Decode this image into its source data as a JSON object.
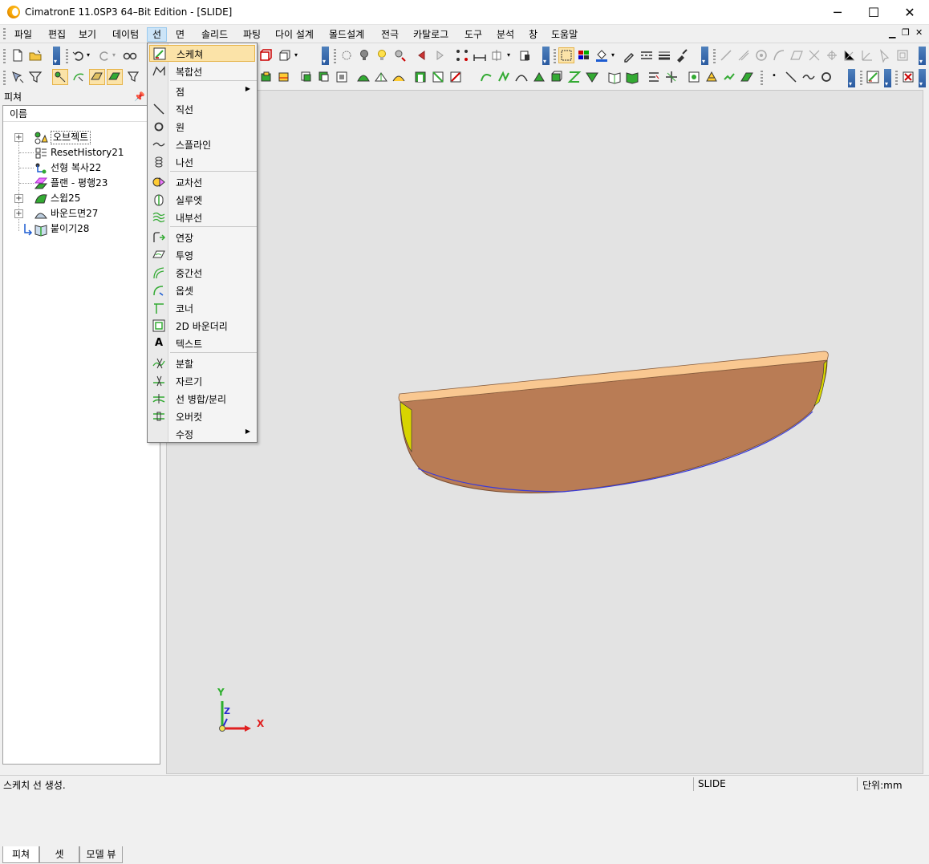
{
  "window": {
    "title": "CimatronE 11.0SP3 64–Bit Edition - [SLIDE]"
  },
  "menubar": {
    "items": [
      "파일",
      "편집",
      "보기",
      "데이텀",
      "선",
      "면",
      "솔리드",
      "파팅",
      "다이 설계",
      "몰드설계",
      "전극",
      "카탈로그",
      "도구",
      "분석",
      "창",
      "도움말"
    ],
    "active": "선"
  },
  "panel": {
    "title": "피쳐",
    "column_header": "이름",
    "tree": [
      {
        "label": "오브젝트",
        "expandable": true
      },
      {
        "label": "ResetHistory21",
        "expandable": false
      },
      {
        "label": "선형 복사22",
        "expandable": false
      },
      {
        "label": "플랜 - 평행23",
        "expandable": false
      },
      {
        "label": "스윕25",
        "expandable": true
      },
      {
        "label": "바운드면27",
        "expandable": true
      },
      {
        "label": "붙이기28",
        "expandable": false
      }
    ],
    "tabs": [
      "피쳐",
      "셋",
      "모델 뷰"
    ],
    "active_tab": "피쳐"
  },
  "dropdown": {
    "items": [
      {
        "label": "스케쳐",
        "icon": "sketcher-icon",
        "highlight": true
      },
      {
        "label": "복합선",
        "icon": "composite-curve-icon"
      },
      {
        "sep": true
      },
      {
        "label": "점",
        "icon": "",
        "submenu": true
      },
      {
        "label": "직선",
        "icon": "line-icon"
      },
      {
        "label": "원",
        "icon": "circle-icon"
      },
      {
        "label": "스플라인",
        "icon": "spline-icon"
      },
      {
        "label": "나선",
        "icon": "helix-icon"
      },
      {
        "sep": true
      },
      {
        "label": "교차선",
        "icon": "intersection-curve-icon"
      },
      {
        "label": "실루엣",
        "icon": "silhouette-icon"
      },
      {
        "label": "내부선",
        "icon": "internal-curve-icon"
      },
      {
        "sep": true
      },
      {
        "label": "연장",
        "icon": "extend-icon"
      },
      {
        "label": "투영",
        "icon": "project-icon"
      },
      {
        "label": "중간선",
        "icon": "middle-curve-icon"
      },
      {
        "label": "옵셋",
        "icon": "offset-icon"
      },
      {
        "label": "코너",
        "icon": "corner-icon"
      },
      {
        "label": "2D 바운더리",
        "icon": "boundary-2d-icon"
      },
      {
        "label": "텍스트",
        "icon": "text-icon"
      },
      {
        "sep": true
      },
      {
        "label": "분할",
        "icon": "split-icon"
      },
      {
        "label": "자르기",
        "icon": "trim-icon"
      },
      {
        "label": "선 병합/분리",
        "icon": "merge-split-icon"
      },
      {
        "label": "오버컷",
        "icon": "overcut-icon"
      },
      {
        "label": "수정",
        "icon": "",
        "submenu": true
      }
    ]
  },
  "viewport": {
    "axis": {
      "x": "X",
      "y": "Y",
      "z": "Z"
    },
    "colors": {
      "top_face": "#f9c891",
      "side_face": "#b97c55",
      "edge_yellow": "#d8d400",
      "edge_blue": "#3b3bd8"
    }
  },
  "statusbar": {
    "message": "스케치 선 생성.",
    "model": "SLIDE",
    "units": "단위:mm"
  }
}
